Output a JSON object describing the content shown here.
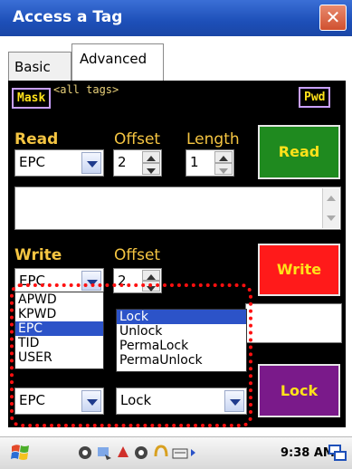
{
  "window": {
    "title": "Access a Tag",
    "close_label": "✕"
  },
  "tabs": [
    {
      "label": "Basic"
    },
    {
      "label": "Advanced"
    }
  ],
  "filter": {
    "mask_label": "Mask",
    "mask_value": "<all tags>",
    "pwd_label": "Pwd"
  },
  "read": {
    "section_label": "Read",
    "offset_label": "Offset",
    "length_label": "Length",
    "bank_value": "EPC",
    "offset_value": "2",
    "length_value": "1",
    "button_label": "Read"
  },
  "write": {
    "section_label": "Write",
    "offset_label": "Offset",
    "bank_value": "EPC",
    "offset_value": "2",
    "button_label": "Write"
  },
  "bank_dropdown": {
    "options": [
      "APWD",
      "KPWD",
      "EPC",
      "TID",
      "USER"
    ],
    "selected": "EPC"
  },
  "lock_dropdown": {
    "options": [
      "Lock",
      "Unlock",
      "PermaLock",
      "PermaUnlock"
    ],
    "selected": "Lock"
  },
  "lock": {
    "bank_value": "EPC",
    "action_value": "Lock",
    "button_label": "Lock"
  },
  "colors": {
    "read_button": "#1f8a1f",
    "write_button": "#ff1a1a",
    "lock_button": "#7a1a8a",
    "highlight": "#ff1010"
  },
  "taskbar": {
    "time": "9:38 AM"
  }
}
